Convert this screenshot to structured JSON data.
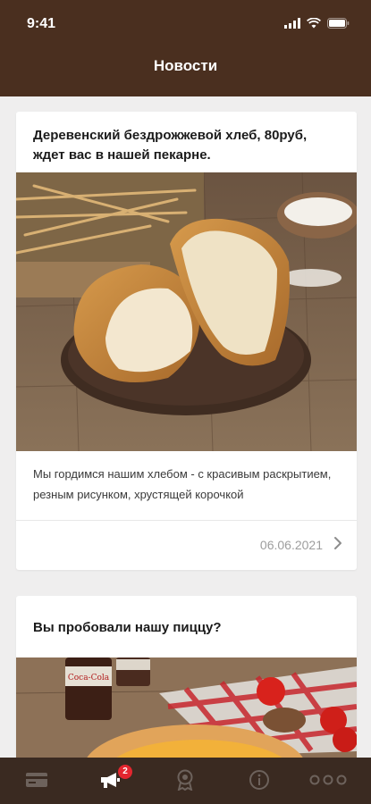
{
  "status_bar": {
    "time": "9:41"
  },
  "header": {
    "title": "Новости"
  },
  "news": [
    {
      "title": "Деревенский бездрожжевой хлеб, 80руб, ждет вас в нашей пекарне.",
      "text": "Мы гордимся нашим хлебом - с красивым раскрытием, резным рисунком, хрустящей корочкой",
      "date": "06.06.2021",
      "image_icon": "bread-photo"
    },
    {
      "title": "Вы пробовали нашу пиццу?",
      "image_icon": "pizza-photo",
      "image_label": "Coca-Cola"
    }
  ],
  "tabbar": {
    "items": [
      {
        "icon": "card-icon"
      },
      {
        "icon": "megaphone-icon",
        "badge": "2"
      },
      {
        "icon": "award-icon"
      },
      {
        "icon": "info-icon"
      },
      {
        "icon": "more-icon"
      }
    ]
  },
  "colors": {
    "header": "#4a2f1f",
    "tabbar": "#3a2a21",
    "badge": "#e3262f",
    "background": "#efeeee"
  }
}
